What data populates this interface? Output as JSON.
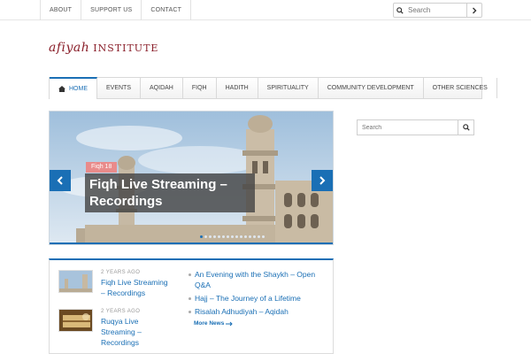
{
  "topbar": {
    "links": [
      "ABOUT",
      "SUPPORT US",
      "CONTACT"
    ],
    "search_placeholder": "Search"
  },
  "logo": {
    "part1": "afiyah",
    "part2": "INSTITUTE"
  },
  "nav": {
    "items": [
      "HOME",
      "EVENTS",
      "AQIDAH",
      "FIQH",
      "HADITH",
      "SPIRITUALITY",
      "COMMUNITY DEVELOPMENT",
      "OTHER SCIENCES"
    ]
  },
  "slider": {
    "tag": "Fiqh 18",
    "title": "Fiqh Live Streaming – Recordings"
  },
  "news": {
    "posts": [
      {
        "ago": "2 YEARS AGO",
        "title": "Fiqh Live Streaming – Recordings"
      },
      {
        "ago": "2 YEARS AGO",
        "title": "Ruqya Live Streaming – Recordings"
      }
    ],
    "links": [
      "An Evening with the Shaykh – Open Q&A",
      "Hajj – The Journey of a Lifetime",
      "Risalah Adhudiyah – Aqidah"
    ],
    "more_label": "More News"
  },
  "sidebar": {
    "search_placeholder": "Search"
  },
  "colors": {
    "accent": "#1a6fb5",
    "logo": "#8a1f2a",
    "tag": "#e98b8b"
  }
}
